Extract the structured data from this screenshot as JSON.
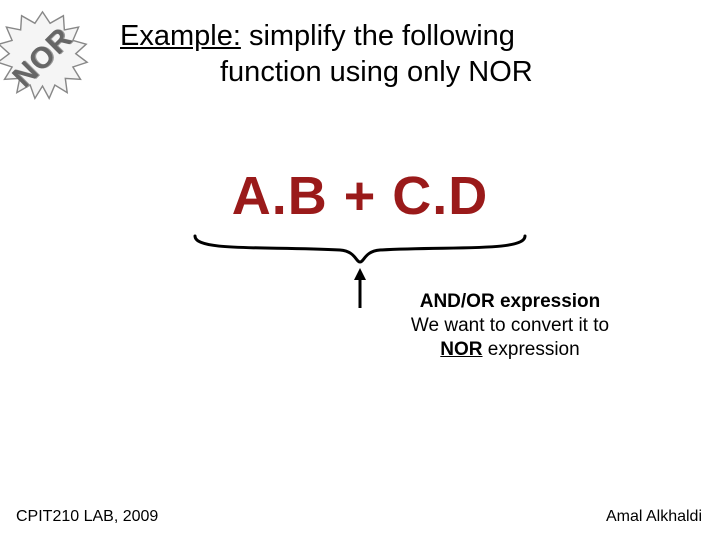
{
  "badge": {
    "label": "NOR"
  },
  "header": {
    "prefix": "Example:",
    "rest1": " simplify the following",
    "line2": "function using only NOR"
  },
  "equation": {
    "t1": "A",
    "dot1": ".",
    "t2": "B",
    "plus": " + ",
    "t3": "C",
    "dot2": ".",
    "t4": "D"
  },
  "caption": {
    "l1": "AND/OR expression",
    "l2a": "We want to convert it to",
    "l3a": "NOR",
    "l3b": " expression"
  },
  "footer": {
    "left": "CPIT210 LAB, 2009",
    "right": "Amal Alkhaldi"
  }
}
